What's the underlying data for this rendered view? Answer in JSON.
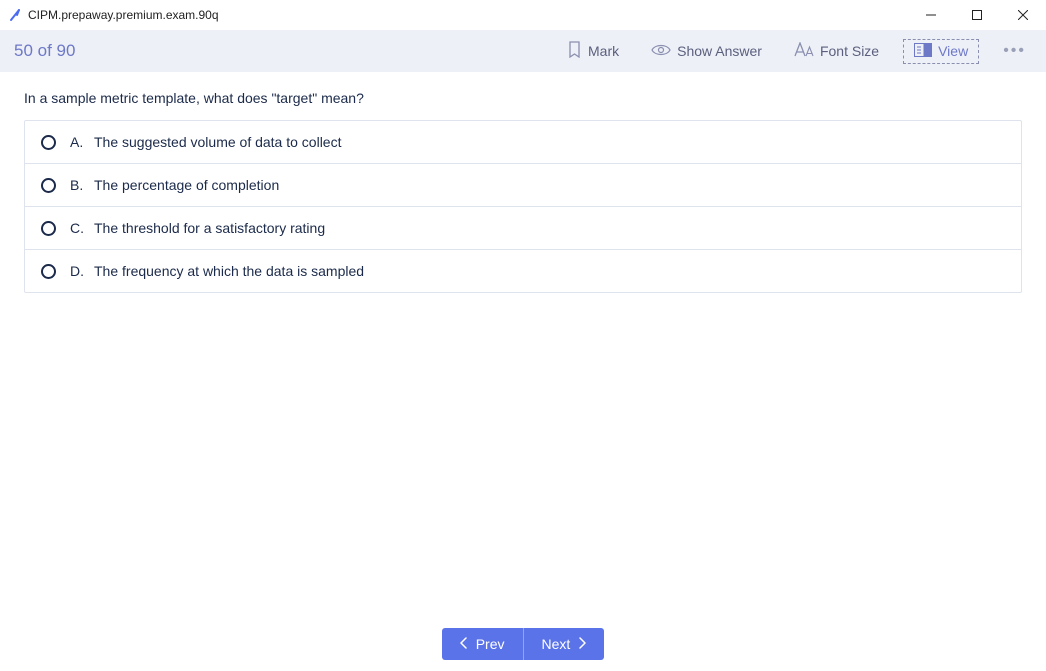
{
  "window": {
    "title": "CIPM.prepaway.premium.exam.90q"
  },
  "toolbar": {
    "progress": "50 of 90",
    "mark": "Mark",
    "show_answer": "Show Answer",
    "font_size": "Font Size",
    "view": "View"
  },
  "question": {
    "text": "In a sample metric template, what does \"target\" mean?",
    "options": [
      {
        "letter": "A.",
        "text": "The suggested volume of data to collect"
      },
      {
        "letter": "B.",
        "text": "The percentage of completion"
      },
      {
        "letter": "C.",
        "text": "The threshold for a satisfactory rating"
      },
      {
        "letter": "D.",
        "text": "The frequency at which the data is sampled"
      }
    ]
  },
  "footer": {
    "prev": "Prev",
    "next": "Next"
  }
}
